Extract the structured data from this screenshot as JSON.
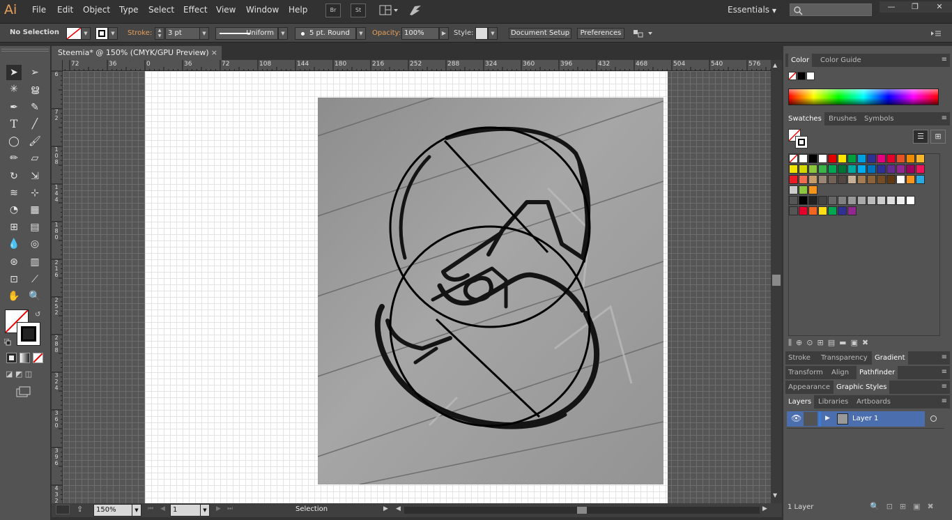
{
  "app": {
    "logo": "Ai",
    "workspace": "Essentials"
  },
  "menu": [
    "File",
    "Edit",
    "Object",
    "Type",
    "Select",
    "Effect",
    "View",
    "Window",
    "Help"
  ],
  "topbar": {
    "bridge": "Br",
    "stock": "St"
  },
  "window_controls": {
    "minimize": "—",
    "restore": "❐",
    "close": "✕"
  },
  "control": {
    "selection": "No Selection",
    "stroke_label": "Stroke:",
    "stroke_value": "3 pt",
    "profile": "Uniform",
    "brush": "5 pt. Round",
    "opacity_label": "Opacity:",
    "opacity_value": "100%",
    "style_label": "Style:",
    "doc_setup": "Document Setup",
    "preferences": "Preferences"
  },
  "document": {
    "tab": "Steemia* @ 150% (CMYK/GPU Preview)",
    "close": "×"
  },
  "ruler": {
    "h": [
      "72",
      "36",
      "0",
      "36",
      "72",
      "108",
      "144",
      "180",
      "216",
      "252",
      "288",
      "324",
      "360",
      "396",
      "432",
      "468",
      "504",
      "540",
      "576"
    ],
    "v": [
      "6",
      "7\n2",
      "1\n0\n8",
      "1\n4\n4",
      "1\n8\n0",
      "2\n1\n6",
      "2\n5\n2",
      "2\n8\n8",
      "3\n2\n4",
      "3\n6\n0",
      "3\n9\n6",
      "4\n3\n2"
    ]
  },
  "status": {
    "zoom": "150%",
    "page": "1",
    "tool": "Selection"
  },
  "panels": {
    "color_tabs": [
      "Color",
      "Color Guide"
    ],
    "swatch_tabs": [
      "Swatches",
      "Brushes",
      "Symbols"
    ],
    "stroke_tabs": [
      "Stroke",
      "Transparency",
      "Gradient"
    ],
    "transform_tabs": [
      "Transform",
      "Align",
      "Pathfinder"
    ],
    "appearance_tabs": [
      "Appearance",
      "Graphic Styles"
    ],
    "layers_tabs": [
      "Layers",
      "Libraries",
      "Artboards"
    ],
    "layer_name": "Layer 1",
    "layer_count": "1 Layer"
  },
  "colors": {
    "accent": "#e8a15a",
    "ui_bg": "#535353",
    "dark": "#323232",
    "selected_layer": "#4b6eaf"
  }
}
